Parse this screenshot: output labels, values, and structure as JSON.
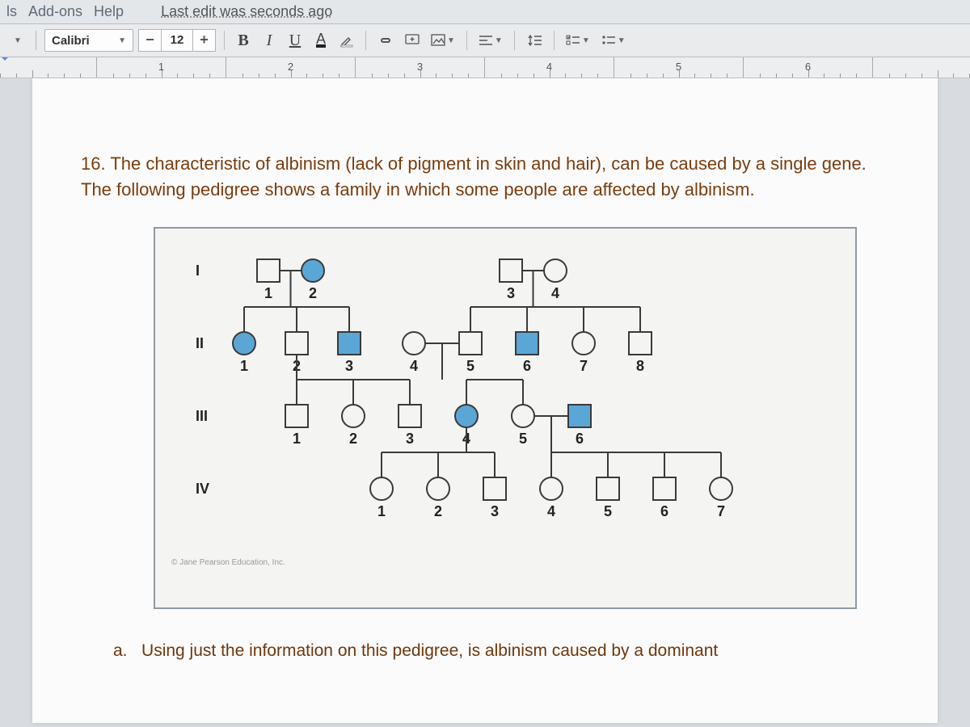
{
  "menubar": {
    "items": [
      "ls",
      "Add-ons",
      "Help"
    ],
    "last_edit": "Last edit was seconds ago"
  },
  "toolbar": {
    "font_name": "Calibri",
    "font_size": "12",
    "minus": "−",
    "plus": "+",
    "bold": "B",
    "italic": "I",
    "underline": "U",
    "textcolor": "A"
  },
  "ruler": {
    "marks": [
      "1",
      "2",
      "3",
      "4",
      "5",
      "6"
    ]
  },
  "document": {
    "q_num": "16.",
    "q_text": "The characteristic of albinism (lack of pigment in skin and hair), can be caused by a single gene.  The following pedigree shows a family in which some people are affected by albinism.",
    "sub_letter": "a.",
    "sub_text": "Using just the information on this pedigree, is albinism caused by a dominant",
    "copyright": "© Jane Pearson Education, Inc."
  },
  "chart_data": {
    "type": "pedigree",
    "legend": {
      "square": "male",
      "circle": "female",
      "filled": "affected",
      "unfilled": "unaffected"
    },
    "generations": [
      {
        "label": "I",
        "individuals": [
          {
            "id": 1,
            "sex": "M",
            "affected": false
          },
          {
            "id": 2,
            "sex": "F",
            "affected": true
          },
          {
            "id": 3,
            "sex": "M",
            "affected": false
          },
          {
            "id": 4,
            "sex": "F",
            "affected": false
          }
        ],
        "unions": [
          {
            "parents": [
              "I-1",
              "I-2"
            ],
            "children": [
              "II-1",
              "II-2",
              "II-3"
            ]
          },
          {
            "parents": [
              "I-3",
              "I-4"
            ],
            "children": [
              "II-5",
              "II-6",
              "II-7",
              "II-8"
            ]
          }
        ]
      },
      {
        "label": "II",
        "individuals": [
          {
            "id": 1,
            "sex": "F",
            "affected": true
          },
          {
            "id": 2,
            "sex": "M",
            "affected": false
          },
          {
            "id": 3,
            "sex": "M",
            "affected": true
          },
          {
            "id": 4,
            "sex": "F",
            "affected": false
          },
          {
            "id": 5,
            "sex": "M",
            "affected": false
          },
          {
            "id": 6,
            "sex": "M",
            "affected": true
          },
          {
            "id": 7,
            "sex": "F",
            "affected": false
          },
          {
            "id": 8,
            "sex": "M",
            "affected": false
          }
        ],
        "unions": [
          {
            "parents": [
              "II-2",
              "II-w"
            ],
            "children": [
              "III-1",
              "III-2",
              "III-3"
            ]
          },
          {
            "parents": [
              "II-4",
              "II-5"
            ],
            "children": [
              "III-4",
              "III-5"
            ]
          }
        ]
      },
      {
        "label": "III",
        "individuals": [
          {
            "id": 1,
            "sex": "M",
            "affected": false
          },
          {
            "id": 2,
            "sex": "F",
            "affected": false
          },
          {
            "id": 3,
            "sex": "M",
            "affected": false
          },
          {
            "id": 4,
            "sex": "F",
            "affected": true
          },
          {
            "id": 5,
            "sex": "F",
            "affected": false
          },
          {
            "id": 6,
            "sex": "M",
            "affected": true
          }
        ],
        "unions": [
          {
            "parents": [
              "III-4",
              "III-m"
            ],
            "children": [
              "IV-1",
              "IV-2",
              "IV-3"
            ]
          },
          {
            "parents": [
              "III-5",
              "III-6"
            ],
            "children": [
              "IV-4",
              "IV-5",
              "IV-6",
              "IV-7"
            ]
          }
        ]
      },
      {
        "label": "IV",
        "individuals": [
          {
            "id": 1,
            "sex": "F",
            "affected": false
          },
          {
            "id": 2,
            "sex": "F",
            "affected": false
          },
          {
            "id": 3,
            "sex": "M",
            "affected": false
          },
          {
            "id": 4,
            "sex": "F",
            "affected": false
          },
          {
            "id": 5,
            "sex": "M",
            "affected": false
          },
          {
            "id": 6,
            "sex": "M",
            "affected": false
          },
          {
            "id": 7,
            "sex": "F",
            "affected": false
          }
        ]
      }
    ]
  }
}
